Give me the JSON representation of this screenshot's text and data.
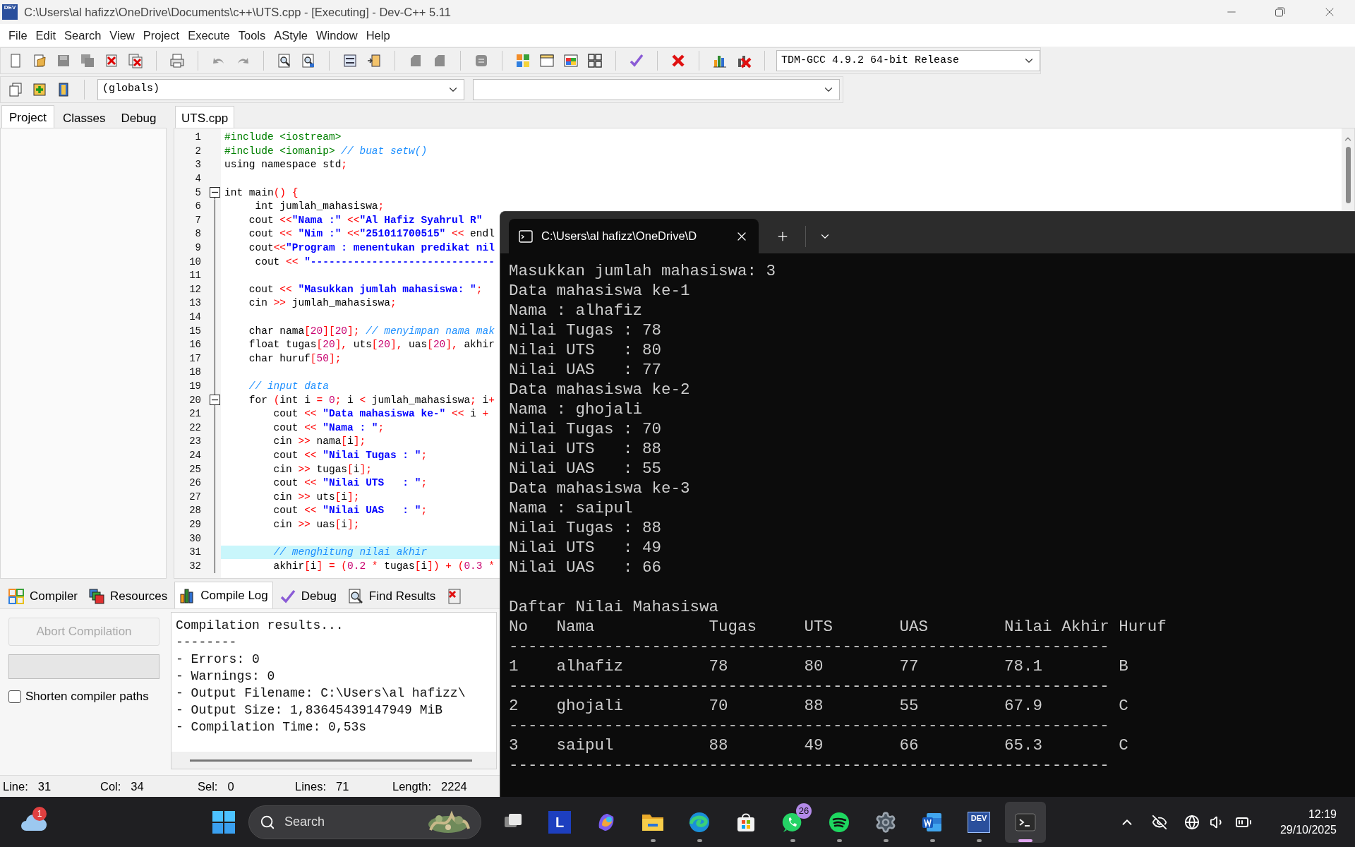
{
  "window": {
    "icon_label": "DEV",
    "title": "C:\\Users\\al hafizz\\OneDrive\\Documents\\c++\\UTS.cpp - [Executing] - Dev-C++ 5.11"
  },
  "menu": [
    "File",
    "Edit",
    "Search",
    "View",
    "Project",
    "Execute",
    "Tools",
    "AStyle",
    "Window",
    "Help"
  ],
  "toolbar": {
    "compiler": "TDM-GCC 4.9.2 64-bit Release",
    "scope": "(globals)"
  },
  "left_tabs": [
    {
      "label": "Project",
      "selected": true
    },
    {
      "label": "Classes",
      "selected": false
    },
    {
      "label": "Debug",
      "selected": false
    }
  ],
  "editor": {
    "tabs": [
      {
        "label": "UTS.cpp",
        "selected": true
      }
    ],
    "lines": [
      {
        "number": "1",
        "fold": false,
        "current": false,
        "text": "#include <iostream>"
      },
      {
        "number": "2",
        "fold": false,
        "current": false,
        "text": "#include <iomanip> // buat setw()"
      },
      {
        "number": "3",
        "fold": false,
        "current": false,
        "text": "using namespace std;"
      },
      {
        "number": "4",
        "fold": false,
        "current": false
      },
      {
        "number": "5",
        "fold": true,
        "current": false,
        "text": "int main() {"
      },
      {
        "number": "6",
        "fold": false,
        "current": false,
        "text": "     int jumlah_mahasiswa;"
      },
      {
        "number": "7",
        "fold": false,
        "current": false,
        "text": "    cout <<\"Nama :\" <<\"Al Hafiz Syahrul R\""
      },
      {
        "number": "8",
        "fold": false,
        "current": false,
        "text": "    cout << \"Nim :\" <<\"251011700515\" << endl"
      },
      {
        "number": "9",
        "fold": false,
        "current": false,
        "text": "    cout<<\"Program : menentukan predikat nil"
      },
      {
        "number": "10",
        "fold": false,
        "current": false,
        "text": "     cout << \"------------------------------"
      },
      {
        "number": "11",
        "fold": false,
        "current": false
      },
      {
        "number": "12",
        "fold": false,
        "current": false,
        "text": "    cout << \"Masukkan jumlah mahasiswa: \";"
      },
      {
        "number": "13",
        "fold": false,
        "current": false,
        "text": "    cin >> jumlah_mahasiswa;"
      },
      {
        "number": "14",
        "fold": false,
        "current": false
      },
      {
        "number": "15",
        "fold": false,
        "current": false,
        "text": "    char nama[20][20]; // menyimpan nama mak"
      },
      {
        "number": "16",
        "fold": false,
        "current": false,
        "text": "    float tugas[20], uts[20], uas[20], akhir"
      },
      {
        "number": "17",
        "fold": false,
        "current": false,
        "text": "    char huruf[50];"
      },
      {
        "number": "18",
        "fold": false,
        "current": false
      },
      {
        "number": "19",
        "fold": false,
        "current": false,
        "text": "    // input data"
      },
      {
        "number": "20",
        "fold": true,
        "current": false,
        "text": "    for (int i = 0; i < jumlah_mahasiswa; i+"
      },
      {
        "number": "21",
        "fold": false,
        "current": false,
        "text": "        cout << \"Data mahasiswa ke-\" << i +"
      },
      {
        "number": "22",
        "fold": false,
        "current": false,
        "text": "        cout << \"Nama : \";"
      },
      {
        "number": "23",
        "fold": false,
        "current": false,
        "text": "        cin >> nama[i];"
      },
      {
        "number": "24",
        "fold": false,
        "current": false,
        "text": "        cout << \"Nilai Tugas : \";"
      },
      {
        "number": "25",
        "fold": false,
        "current": false,
        "text": "        cin >> tugas[i];"
      },
      {
        "number": "26",
        "fold": false,
        "current": false,
        "text": "        cout << \"Nilai UTS   : \";"
      },
      {
        "number": "27",
        "fold": false,
        "current": false,
        "text": "        cin >> uts[i];"
      },
      {
        "number": "28",
        "fold": false,
        "current": false,
        "text": "        cout << \"Nilai UAS   : \";"
      },
      {
        "number": "29",
        "fold": false,
        "current": false,
        "text": "        cin >> uas[i];"
      },
      {
        "number": "30",
        "fold": false,
        "current": false
      },
      {
        "number": "31",
        "fold": false,
        "current": true,
        "text": "        // menghitung nilai akhir"
      },
      {
        "number": "32",
        "fold": false,
        "current": false,
        "text": "        akhir[i] = (0.2 * tugas[i]) + (0.3 *"
      }
    ]
  },
  "bottom_tabs": [
    {
      "label": "Compiler",
      "selected": false
    },
    {
      "label": "Resources",
      "selected": false
    },
    {
      "label": "Compile Log",
      "selected": true
    },
    {
      "label": "Debug",
      "selected": false
    },
    {
      "label": "Find Results",
      "selected": false
    },
    {
      "selected": false
    }
  ],
  "compiler_panel": {
    "abort_button": {
      "label": "Abort Compilation",
      "disabled": true
    },
    "progress": {
      "level": 0
    },
    "shorten_paths": {
      "label": "Shorten compiler paths",
      "checked": false
    },
    "log": [
      "Compilation results...",
      "--------",
      "- Errors: 0",
      "- Warnings: 0",
      "- Output Filename: C:\\Users\\al hafizz\\",
      "- Output Size: 1,83645439147949 MiB",
      "- Compilation Time: 0,53s"
    ]
  },
  "status_bar": [
    {
      "label": "Line:",
      "value": "31"
    },
    {
      "label": "Col:",
      "value": "34"
    },
    {
      "label": "Sel:",
      "value": "0"
    },
    {
      "label": "Lines:",
      "value": "71"
    },
    {
      "label": "Length:",
      "value": "2224"
    }
  ],
  "terminal": {
    "tab_title": "C:\\Users\\al hafizz\\OneDrive\\D",
    "lines": [
      "Masukkan jumlah mahasiswa: 3",
      "Data mahasiswa ke-1",
      "Nama : alhafiz",
      "Nilai Tugas : 78",
      "Nilai UTS   : 80",
      "Nilai UAS   : 77",
      "Data mahasiswa ke-2",
      "Nama : ghojali",
      "Nilai Tugas : 70",
      "Nilai UTS   : 88",
      "Nilai UAS   : 55",
      "Data mahasiswa ke-3",
      "Nama : saipul",
      "Nilai Tugas : 88",
      "Nilai UTS   : 49",
      "Nilai UAS   : 66"
    ],
    "table": {
      "title": "Daftar Nilai Mahasiswa",
      "header": "No   Nama            Tugas     UTS       UAS        Nilai Akhir Huruf",
      "header_rule": "---------------------------------------------------------------",
      "rows": [
        {
          "line": "1    alhafiz         78        80        77         78.1        B",
          "rule": "---------------------------------------------------------------"
        },
        {
          "line": "2    ghojali         70        88        55         67.9        C",
          "rule": "---------------------------------------------------------------"
        },
        {
          "line": "3    saipul          88        49        66         65.3        C",
          "rule": "---------------------------------------------------------------"
        }
      ]
    }
  },
  "taskbar": {
    "weather_badge": "1",
    "search": {
      "placeholder": "Search"
    },
    "apps": [
      {
        "kind": "taskview",
        "running": false,
        "selected": false
      },
      {
        "kind": "letter",
        "label": "L",
        "running": false,
        "selected": false
      },
      {
        "kind": "copilot",
        "running": false,
        "selected": false
      },
      {
        "kind": "explorer",
        "running": true,
        "selected": false
      },
      {
        "kind": "edge",
        "running": true,
        "selected": false
      },
      {
        "kind": "store",
        "running": false,
        "selected": false
      },
      {
        "kind": "whatsapp",
        "badge": "26",
        "running": true,
        "selected": false
      },
      {
        "kind": "spotify",
        "running": true,
        "selected": false
      },
      {
        "kind": "settings",
        "running": true,
        "selected": false
      },
      {
        "kind": "word",
        "running": true,
        "selected": false
      },
      {
        "kind": "devcpp",
        "label": "DEV",
        "running": true,
        "selected": false
      },
      {
        "kind": "terminal",
        "running": true,
        "selected": true
      }
    ],
    "tray": {
      "time": "12:19",
      "date": "29/10/2025"
    }
  }
}
